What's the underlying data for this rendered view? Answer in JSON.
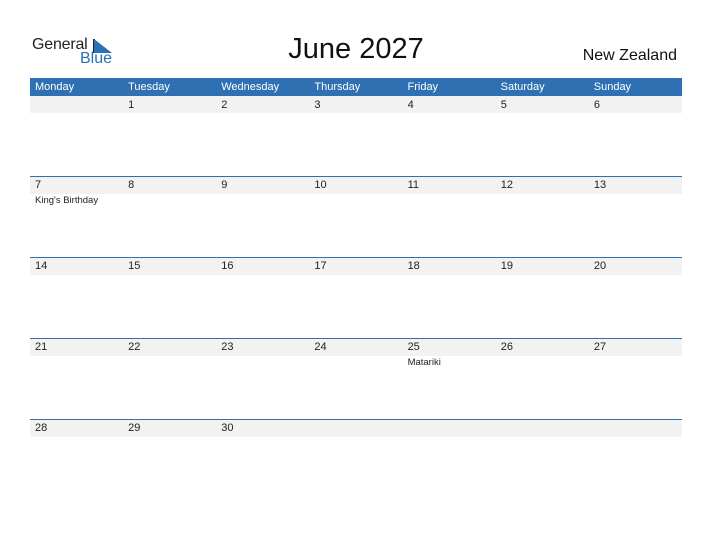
{
  "logo": {
    "line1": "General",
    "line2": "Blue"
  },
  "title": "June 2027",
  "country": "New Zealand",
  "colors": {
    "accent": "#2e70b1",
    "band": "#f2f2f2"
  },
  "weekdays": [
    "Monday",
    "Tuesday",
    "Wednesday",
    "Thursday",
    "Friday",
    "Saturday",
    "Sunday"
  ],
  "weeks": [
    {
      "days": [
        {
          "num": "",
          "event": ""
        },
        {
          "num": "1",
          "event": ""
        },
        {
          "num": "2",
          "event": ""
        },
        {
          "num": "3",
          "event": ""
        },
        {
          "num": "4",
          "event": ""
        },
        {
          "num": "5",
          "event": ""
        },
        {
          "num": "6",
          "event": ""
        }
      ]
    },
    {
      "days": [
        {
          "num": "7",
          "event": "King's Birthday"
        },
        {
          "num": "8",
          "event": ""
        },
        {
          "num": "9",
          "event": ""
        },
        {
          "num": "10",
          "event": ""
        },
        {
          "num": "11",
          "event": ""
        },
        {
          "num": "12",
          "event": ""
        },
        {
          "num": "13",
          "event": ""
        }
      ]
    },
    {
      "days": [
        {
          "num": "14",
          "event": ""
        },
        {
          "num": "15",
          "event": ""
        },
        {
          "num": "16",
          "event": ""
        },
        {
          "num": "17",
          "event": ""
        },
        {
          "num": "18",
          "event": ""
        },
        {
          "num": "19",
          "event": ""
        },
        {
          "num": "20",
          "event": ""
        }
      ]
    },
    {
      "days": [
        {
          "num": "21",
          "event": ""
        },
        {
          "num": "22",
          "event": ""
        },
        {
          "num": "23",
          "event": ""
        },
        {
          "num": "24",
          "event": ""
        },
        {
          "num": "25",
          "event": "Matariki"
        },
        {
          "num": "26",
          "event": ""
        },
        {
          "num": "27",
          "event": ""
        }
      ]
    },
    {
      "days": [
        {
          "num": "28",
          "event": ""
        },
        {
          "num": "29",
          "event": ""
        },
        {
          "num": "30",
          "event": ""
        },
        {
          "num": "",
          "event": ""
        },
        {
          "num": "",
          "event": ""
        },
        {
          "num": "",
          "event": ""
        },
        {
          "num": "",
          "event": ""
        }
      ]
    }
  ]
}
